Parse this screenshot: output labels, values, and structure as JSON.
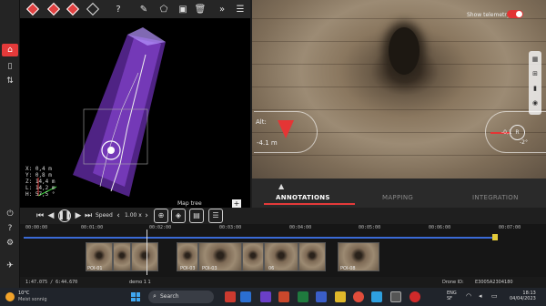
{
  "toolbar3d": {
    "help": "?",
    "icons": [
      "cube-front-icon",
      "cube-side-icon",
      "cube-top-icon",
      "cube-outline-icon",
      "help-icon",
      "pencil-icon",
      "polygon-icon",
      "save-icon",
      "trash-icon",
      "fast-forward-icon",
      "settings-sliders-icon"
    ]
  },
  "view3d": {
    "coords": [
      "X: 0,4 m",
      "Y: 0,8 m",
      "Z: 14,4 m",
      "L: 14,2 m",
      "H: 57,5 °"
    ],
    "map_tree_label": "Map tree",
    "map_tree_button": "+"
  },
  "camera": {
    "telemetry_label": "Show telemetry",
    "telemetry_on": true,
    "alt_label": "Alt:",
    "alt_value": "-4.1 m",
    "pitch_value": "-0,1",
    "pitch_neg": "-2°",
    "pitch_center": "R"
  },
  "tabs": [
    {
      "label": "ANNOTATIONS",
      "active": true
    },
    {
      "label": "MAPPING",
      "active": false
    },
    {
      "label": "INTEGRATION",
      "active": false
    }
  ],
  "playback": {
    "speed_label": "Speed",
    "speed_value": "1.00 x"
  },
  "timeline": {
    "ticks": [
      "00:00:00",
      "00:01:00",
      "00:02:00",
      "00:03:00",
      "00:04:00",
      "00:05:00",
      "00:06:00",
      "00:07:00"
    ],
    "poi_labels": [
      "POI-01",
      "POI-03",
      "POI-03",
      "06",
      "POI-08"
    ]
  },
  "status": {
    "timecode": "1:47.075 / 6:44.670",
    "demo_label": "demo  1  1",
    "drone_label": "Drone ID:",
    "drone_value": "E3005A2304180"
  },
  "taskbar": {
    "weather_temp": "10°C",
    "weather_desc": "Meist sonnig",
    "search_label": "Search",
    "lang_top": "ENG",
    "lang_bottom": "SF",
    "time": "18:13",
    "date": "04/04/2023"
  },
  "colors": {
    "accent": "#e43a3a",
    "track": "#3a6ad6"
  }
}
